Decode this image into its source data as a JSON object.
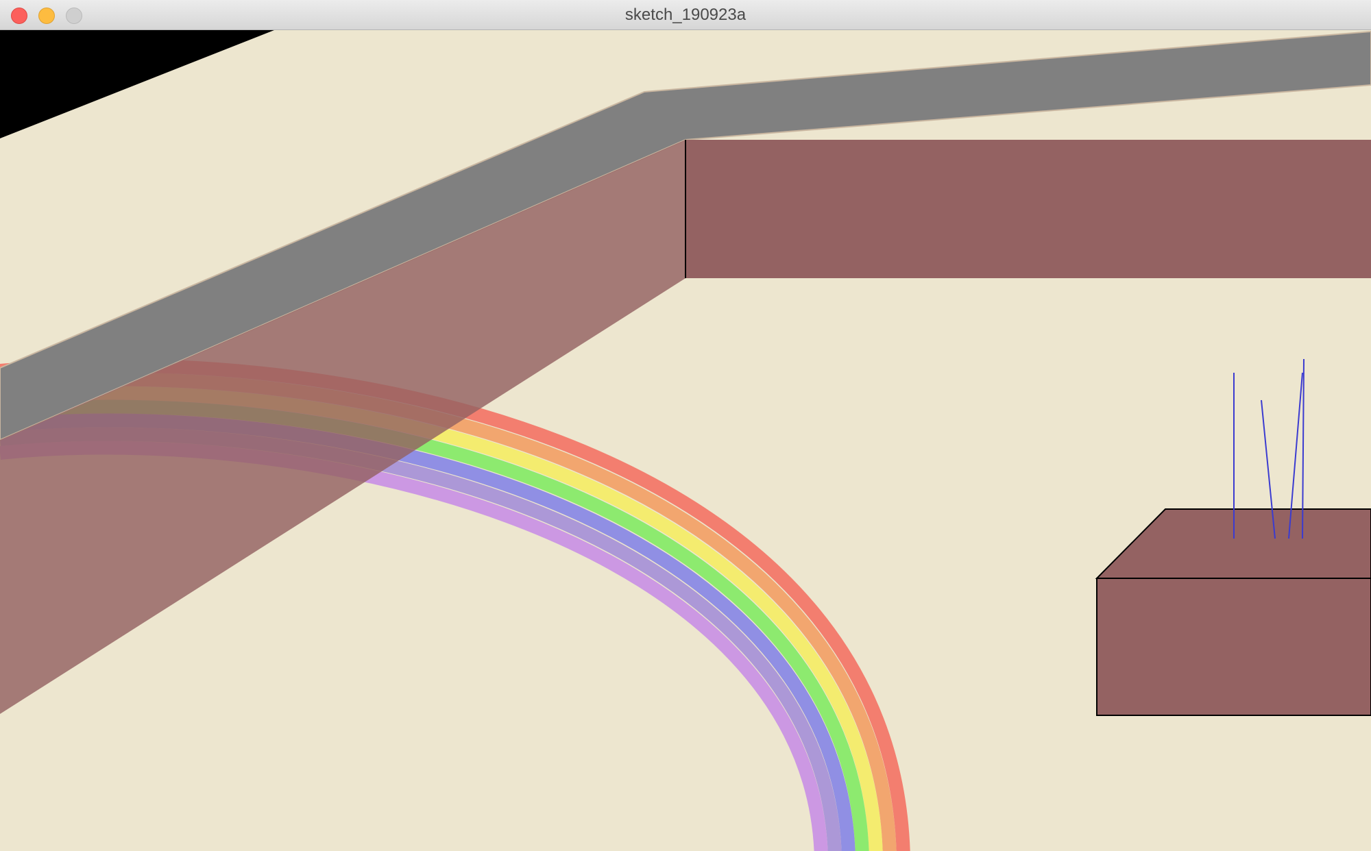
{
  "window": {
    "title": "sketch_190923a",
    "controls": {
      "close": "close-button",
      "minimize": "minimize-button",
      "zoom": "zoom-button"
    }
  },
  "scene": {
    "background_color": "#ede6cf",
    "wall_color": "#946262",
    "wall_top_color": "#808080",
    "corner_fill_color": "#000000",
    "grass_color": "#3b3bd0",
    "rainbow_colors": [
      "#f36b5e",
      "#f29a5e",
      "#f5ec5e",
      "#7bea5e",
      "#7f7fe8",
      "#8b6fd8",
      "#c27fe6"
    ]
  }
}
